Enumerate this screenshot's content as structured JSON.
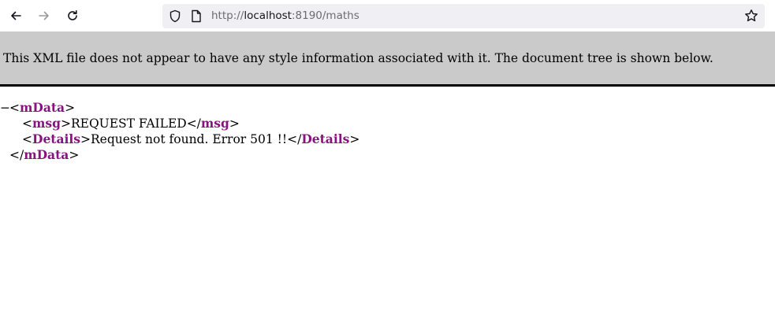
{
  "browser": {
    "url_scheme": "http://",
    "url_host": "localhost",
    "url_rest": ":8190/maths"
  },
  "info_banner": {
    "text": "This XML file does not appear to have any style information associated with it. The document tree is shown below."
  },
  "xml": {
    "collapse_toggle": "−",
    "root_tag": "mData",
    "children": [
      {
        "tag": "msg",
        "text": "REQUEST FAILED"
      },
      {
        "tag": "Details",
        "text": "Request not found. Error 501 !!"
      }
    ]
  }
}
